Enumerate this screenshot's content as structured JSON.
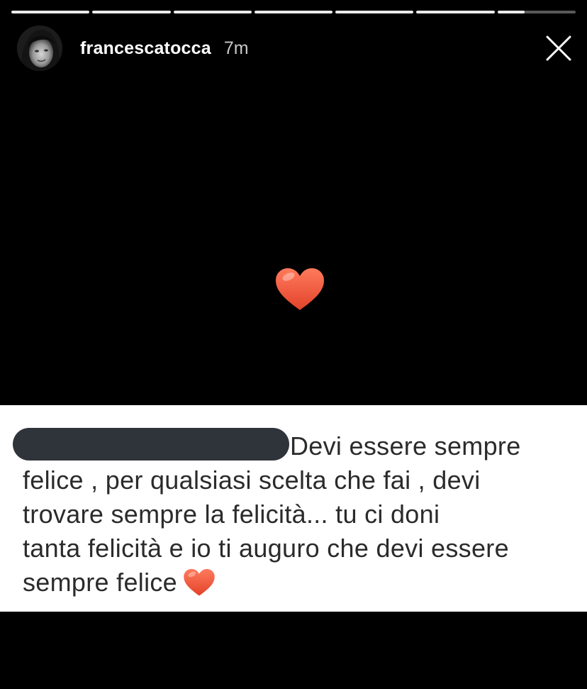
{
  "story": {
    "progress_segments": [
      1,
      1,
      1,
      1,
      1,
      1,
      0.35
    ],
    "username": "francescatocca",
    "time": "7m",
    "avatar_icon": "profile-photo",
    "close_icon": "close-icon",
    "center_emoji": "red-heart"
  },
  "comment": {
    "lines": [
      "Devi essere sempre",
      "felice , per qualsiasi scelta che fai , devi",
      "trovare sempre la felicità... tu ci doni",
      "tanta  felicità e io ti auguro che devi essere",
      "sempre felice"
    ],
    "trailing_emoji": "red-heart"
  },
  "colors": {
    "heart": "#f05a3c",
    "panel_bg": "#ffffff",
    "redaction": "#2f343a"
  }
}
